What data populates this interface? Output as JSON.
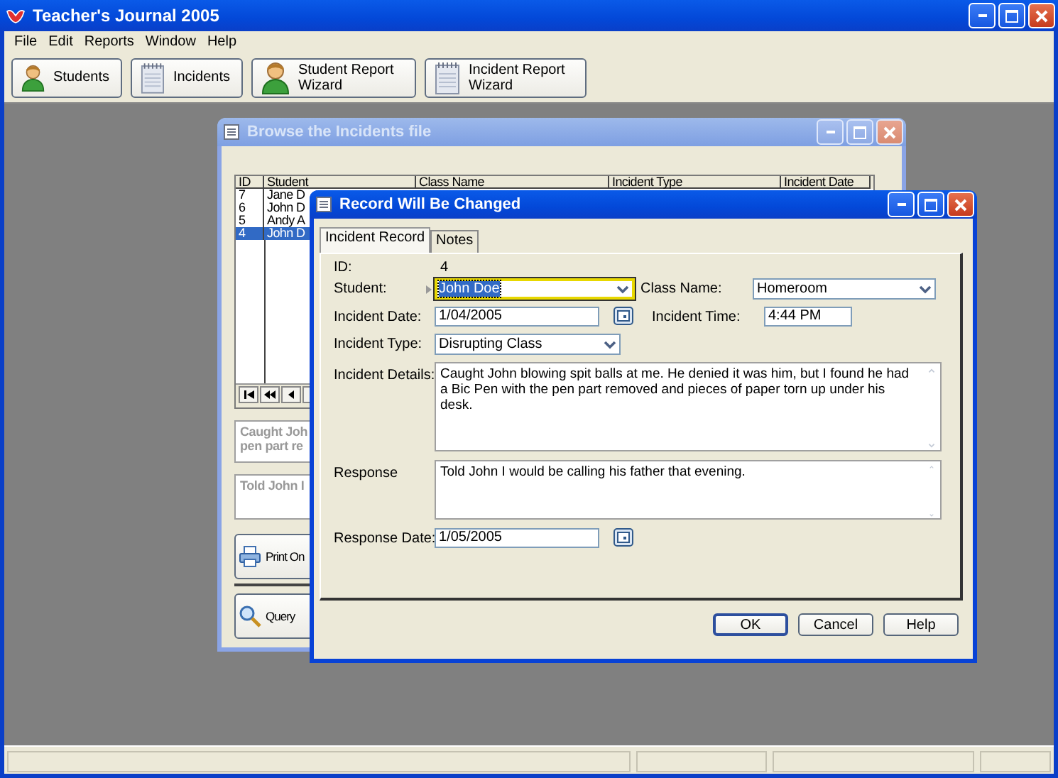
{
  "window": {
    "title": "Teacher's Journal 2005"
  },
  "menu": [
    {
      "label": "File"
    },
    {
      "label": "Edit"
    },
    {
      "label": "Reports"
    },
    {
      "label": "Window"
    },
    {
      "label": "Help"
    }
  ],
  "toolbar": [
    {
      "label": "Students",
      "kind": "person"
    },
    {
      "label": "Incidents",
      "kind": "notepad"
    },
    {
      "label": "Student Report Wizard",
      "kind": "person"
    },
    {
      "label": "Incident Report Wizard",
      "kind": "notepad"
    }
  ],
  "browse_window": {
    "title": "Browse the Incidents file",
    "active": false,
    "columns": [
      "ID",
      "Student",
      "Class Name",
      "Incident Type",
      "Incident Date"
    ],
    "rows": [
      {
        "id": "7",
        "student": "Jane D",
        "selected": false
      },
      {
        "id": "6",
        "student": "John D",
        "selected": false
      },
      {
        "id": "5",
        "student": "Andy A",
        "selected": false
      },
      {
        "id": "4",
        "student": "John D",
        "selected": true
      }
    ],
    "memos": [
      [
        "Caught Joh",
        "pen part re"
      ],
      [
        "Told John I"
      ]
    ],
    "buttons": [
      {
        "label": "Print On",
        "kind": "printer"
      },
      {
        "label": "Query",
        "kind": "magnifier"
      }
    ]
  },
  "dialog": {
    "title": "Record Will Be Changed",
    "active": true,
    "tabs": [
      {
        "label": "Incident Record",
        "selected": true
      },
      {
        "label": "Notes",
        "selected": false
      }
    ],
    "form": [
      [
        {
          "kind": "static",
          "label": "ID:",
          "value": "4"
        }
      ],
      [
        {
          "kind": "combo",
          "label": "Student:",
          "value": "John Doe",
          "focused": true,
          "text_selected": true
        },
        {
          "kind": "combo",
          "label": "Class Name:",
          "value": "Homeroom",
          "focused": false,
          "text_selected": false
        }
      ],
      [
        {
          "kind": "date",
          "label": "Incident Date:",
          "value": "1/04/2005"
        },
        {
          "kind": "text",
          "label": "Incident Time:",
          "value": "4:44 PM"
        }
      ],
      [
        {
          "kind": "combo",
          "label": "Incident Type:",
          "value": "Disrupting Class",
          "focused": false,
          "text_selected": false
        }
      ],
      [
        {
          "kind": "memo",
          "label": "Incident Details:",
          "value": "Caught John blowing spit balls at me.  He denied it was him, but I found he had a Bic Pen with the pen part removed and pieces of paper torn up under his desk."
        }
      ],
      [
        {
          "kind": "memo",
          "label": "Response",
          "value": "Told John I would be calling his father that evening."
        }
      ],
      [
        {
          "kind": "date",
          "label": "Response Date:",
          "value": "1/05/2005"
        }
      ]
    ],
    "buttons": [
      {
        "label": "OK",
        "default": true
      },
      {
        "label": "Cancel",
        "default": false
      },
      {
        "label": "Help",
        "default": false
      }
    ]
  }
}
